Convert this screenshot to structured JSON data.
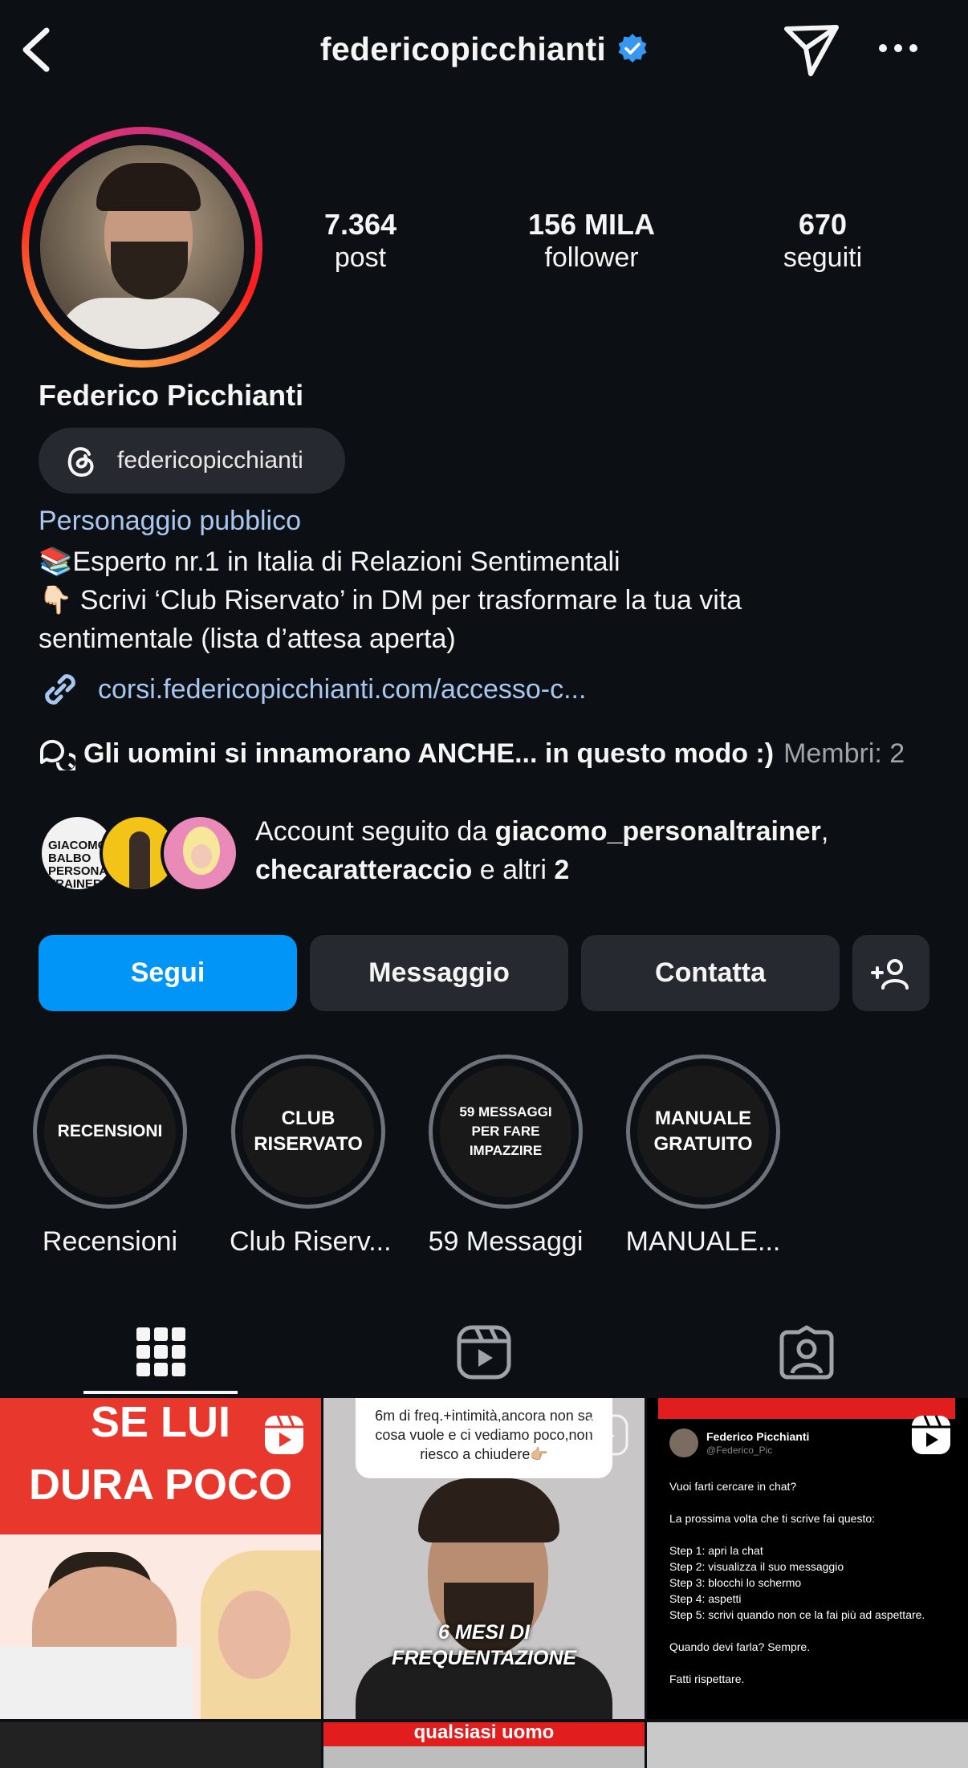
{
  "header": {
    "username": "federicopicchianti",
    "verified": true,
    "icons": [
      "back-chevron-icon",
      "paper-plane-icon",
      "more-dots-icon"
    ]
  },
  "profile": {
    "stats": [
      {
        "value": "7.364",
        "label": "post"
      },
      {
        "value": "156 MILA",
        "label": "follower"
      },
      {
        "value": "670",
        "label": "seguiti"
      }
    ],
    "full_name": "Federico Picchianti",
    "threads_handle": "federicopicchianti",
    "category": "Personaggio pubblico",
    "bio_lines": [
      "📚Esperto nr.1 in Italia di Relazioni Sentimentali",
      "👇🏻 Scrivi ‘Club Riservato’ in DM per trasformare la tua vita",
      "sentimentale (lista d’attesa aperta)"
    ],
    "link": "corsi.federicopicchianti.com/accesso-c...",
    "channel": {
      "title": "Gli uomini si innamorano ANCHE... in questo modo :)",
      "members": "Membri: 2"
    },
    "followed_by": {
      "prefix": "Account seguito da",
      "user1": "giacomo_personaltrainer",
      "user2": "checaratteraccio",
      "middle": "e altri",
      "count": "2",
      "avatar1_text": "GIACOMO BALBO PERSONAL TRAINER"
    }
  },
  "actions": {
    "follow": "Segui",
    "message": "Messaggio",
    "contact": "Contatta"
  },
  "highlights": [
    {
      "cover": "RECENSIONI",
      "label": "Recensioni"
    },
    {
      "cover": "CLUB RISERVATO",
      "label": "Club Riserv..."
    },
    {
      "cover": "59 MESSAGGI PER FARE IMPAZZIRE",
      "label": "59 Messaggi"
    },
    {
      "cover": "MANUALE GRATUITO",
      "label": "MANUALE..."
    }
  ],
  "tabs": [
    "grid-icon",
    "reels-icon",
    "tagged-icon"
  ],
  "posts": [
    {
      "line1": "SE LUI",
      "line2": "DURA POCO"
    },
    {
      "bubble": "6m di freq.+intimità,ancora non sa cosa vuole e ci vediamo poco,non riesco a chiudere👉🏼",
      "caption1": "6 MESI DI",
      "caption2": "FREQUENTAZIONE"
    },
    {
      "author": "Federico Picchianti",
      "handle": "@Federico_Pic",
      "lines": [
        "Vuoi farti cercare in chat?",
        "La prossima volta che ti scrive fai questo:",
        "Step 1: apri la chat",
        "Step 2: visualizza il suo messaggio",
        "Step 3: blocchi lo schermo",
        "Step 4: aspetti",
        "Step 5: scrivi quando non ce la fai più ad aspettare.",
        "Quando devi farla? Sempre.",
        "Fatti rispettare."
      ]
    }
  ],
  "peek": {
    "p2_text": "qualsiasi uomo"
  },
  "colors": {
    "background": "#0c1014",
    "accent": "#0095f6",
    "link": "#a8c7f0",
    "button": "#262a30"
  }
}
